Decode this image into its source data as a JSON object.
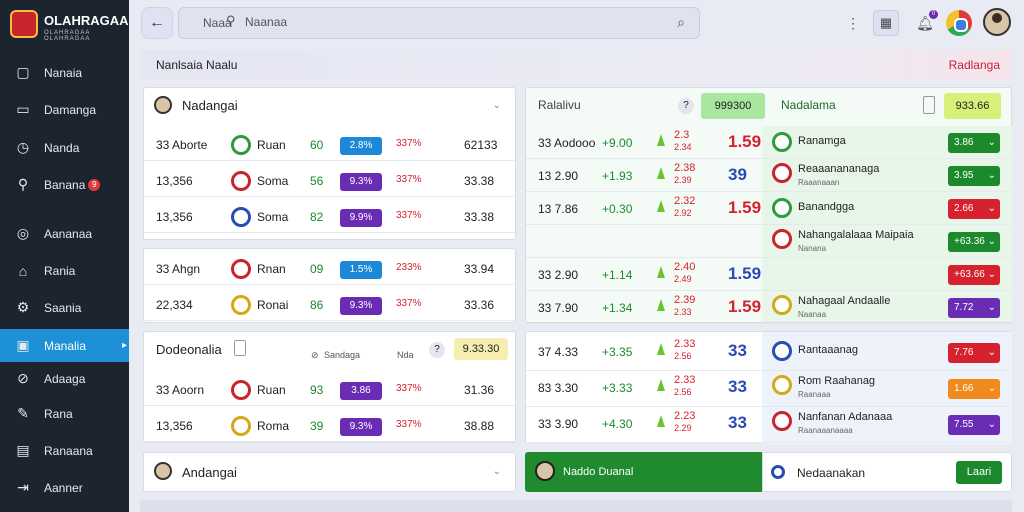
{
  "brand": {
    "name": "OLAHRAGAA",
    "sub": "OLAHRAGAA OLAHRAGAA"
  },
  "nav": [
    {
      "label": "Nanaia",
      "icon": "square-icon"
    },
    {
      "label": "Damanga",
      "icon": "tablet-icon"
    },
    {
      "label": "Nanda",
      "icon": "clock-icon"
    },
    {
      "label": "Banana",
      "icon": "search-icon",
      "badge": "9"
    },
    {
      "label": "Aananaa",
      "icon": "globe-icon"
    },
    {
      "label": "Rania",
      "icon": "home-icon"
    },
    {
      "label": "Saania",
      "icon": "gear-icon"
    },
    {
      "label": "Manalia",
      "icon": "calendar-icon",
      "active": true
    },
    {
      "label": "Adaaga",
      "icon": "compass-icon"
    },
    {
      "label": "Rana",
      "icon": "wand-icon"
    },
    {
      "label": "Ranaana",
      "icon": "inbox-icon"
    },
    {
      "label": "Aanner",
      "icon": "logout-icon"
    }
  ],
  "search": {
    "t1": "Naaa",
    "t2": "Naanaa"
  },
  "topbar": {
    "bell_badge": "0"
  },
  "header": {
    "left": "Nanlsaia Naalu",
    "right": "Radlanga"
  },
  "left_panel": {
    "card1": {
      "title": "Nadangai",
      "rows": [
        {
          "a": "33 Aborte",
          "team": "Ruan",
          "n": "60",
          "pill": "2.8%",
          "pct": "337%",
          "val": "62133",
          "ic": "#2f9a3f",
          "pc": "#1e88d8"
        },
        {
          "a": "13,356",
          "team": "Soma",
          "n": "56",
          "pill": "9.3%",
          "pct": "337%",
          "val": "33.38",
          "ic": "#c8242b",
          "pc": "#6a2bb5"
        },
        {
          "a": "13,356",
          "team": "Soma",
          "n": "82",
          "pill": "9.9%",
          "pct": "337%",
          "val": "33.38",
          "ic": "#2a4bb0",
          "pc": "#6a2bb5"
        }
      ]
    },
    "card2": {
      "rows": [
        {
          "a": "33 Ahgn",
          "team": "Rnan",
          "n": "09",
          "pill": "1.5%",
          "pct": "233%",
          "val": "33.94",
          "ic": "#c8242b",
          "pc": "#1e88d8"
        },
        {
          "a": "22,334",
          "team": "Ronai",
          "n": "86",
          "pill": "9.3%",
          "pct": "337%",
          "val": "33.36",
          "ic": "#d4a817",
          "pc": "#6a2bb5"
        }
      ]
    },
    "card3": {
      "title": "Dodeonalia",
      "filter": "Sandaga",
      "filter_right": "Nda",
      "help": "?",
      "chip": "9.33.30",
      "rows": [
        {
          "a": "33 Aoorn",
          "team": "Ruan",
          "n": "93",
          "pill": "3.86",
          "pct": "337%",
          "val": "31.36",
          "ic": "#c8242b",
          "pc": "#6a2bb5"
        },
        {
          "a": "13,356",
          "team": "Roma",
          "n": "39",
          "pill": "9.3%",
          "pct": "337%",
          "val": "38.88",
          "ic": "#d4a817",
          "pc": "#6a2bb5"
        }
      ]
    },
    "card4": {
      "title": "Andangai"
    }
  },
  "right_panel": {
    "title": "Ralalivu",
    "chip1": "999300",
    "mid": "Nadalama",
    "chip2": "933.66",
    "rows": [
      {
        "a": "33 Aodooo",
        "b": "+9.00",
        "s1": "2.3",
        "s2": "2.34",
        "big": "1.59",
        "bigc": "red",
        "team": "Ranamga",
        "sub": "",
        "odd": "3.86",
        "oc": "#1c8a2c",
        "ic": "#2f9a3f"
      },
      {
        "a": "13 2.90",
        "b": "+1.93",
        "s1": "2.38",
        "s2": "2.39",
        "big": "39",
        "bigc": "blue",
        "team": "Reaaanananaga",
        "sub": "Raaanaaan",
        "odd": "3.95",
        "oc": "#1c8a2c",
        "ic": "#c8242b"
      },
      {
        "a": "13 7.86",
        "b": "+0.30",
        "s1": "2.32",
        "s2": "2.92",
        "big": "1.59",
        "bigc": "red",
        "team": "Banandgga",
        "sub": "",
        "odd": "2.66",
        "oc": "#d6222e",
        "ic": "#2f9a3f"
      },
      {
        "a": "",
        "b": "",
        "s1": "",
        "s2": "",
        "big": "",
        "bigc": "",
        "team": "Nahangalalaaa Maipaia",
        "sub": "Nanana",
        "odd": "+63.36",
        "oc": "#1c8a2c",
        "ic": "#c8242b"
      },
      {
        "a": "33 2.90",
        "b": "+1.14",
        "s1": "2.40",
        "s2": "2.49",
        "big": "1.59",
        "bigc": "blue",
        "team": "",
        "sub": "",
        "odd": "+63.66",
        "oc": "#d6222e",
        "ic": ""
      },
      {
        "a": "33 7.90",
        "b": "+1.34",
        "s1": "2.39",
        "s2": "2.33",
        "big": "1.59",
        "bigc": "red",
        "team": "Nahagaal Andaalle",
        "sub": "Naanaa",
        "odd": "7.72",
        "oc": "#6a2bb5",
        "ic": "#d4a817"
      }
    ],
    "rows2": [
      {
        "a": "37 4.33",
        "b": "+3.35",
        "s1": "2.33",
        "s2": "2.56",
        "big": "33",
        "bigc": "blue",
        "team": "Rantaaanag",
        "sub": "",
        "odd": "7.76",
        "oc": "#d6222e",
        "ic": "#2a4bb0"
      },
      {
        "a": "83 3.30",
        "b": "+3.33",
        "s1": "2.33",
        "s2": "2.56",
        "big": "33",
        "bigc": "blue",
        "team": "Rom Raahanag",
        "sub": "Raanaaa",
        "odd": "1.66",
        "oc": "#f08a1c",
        "ic": "#d4a817"
      },
      {
        "a": "33 3.90",
        "b": "+4.30",
        "s1": "2.23",
        "s2": "2.29",
        "big": "33",
        "bigc": "blue",
        "team": "Nanfanan Adanaaa",
        "sub": "Raanaaanaaaa",
        "odd": "7.55",
        "oc": "#6a2bb5",
        "ic": "#c8242b"
      }
    ],
    "footer": {
      "left": "Naddo Duanal",
      "right": "Nedaanakan",
      "btn": "Laari"
    }
  }
}
